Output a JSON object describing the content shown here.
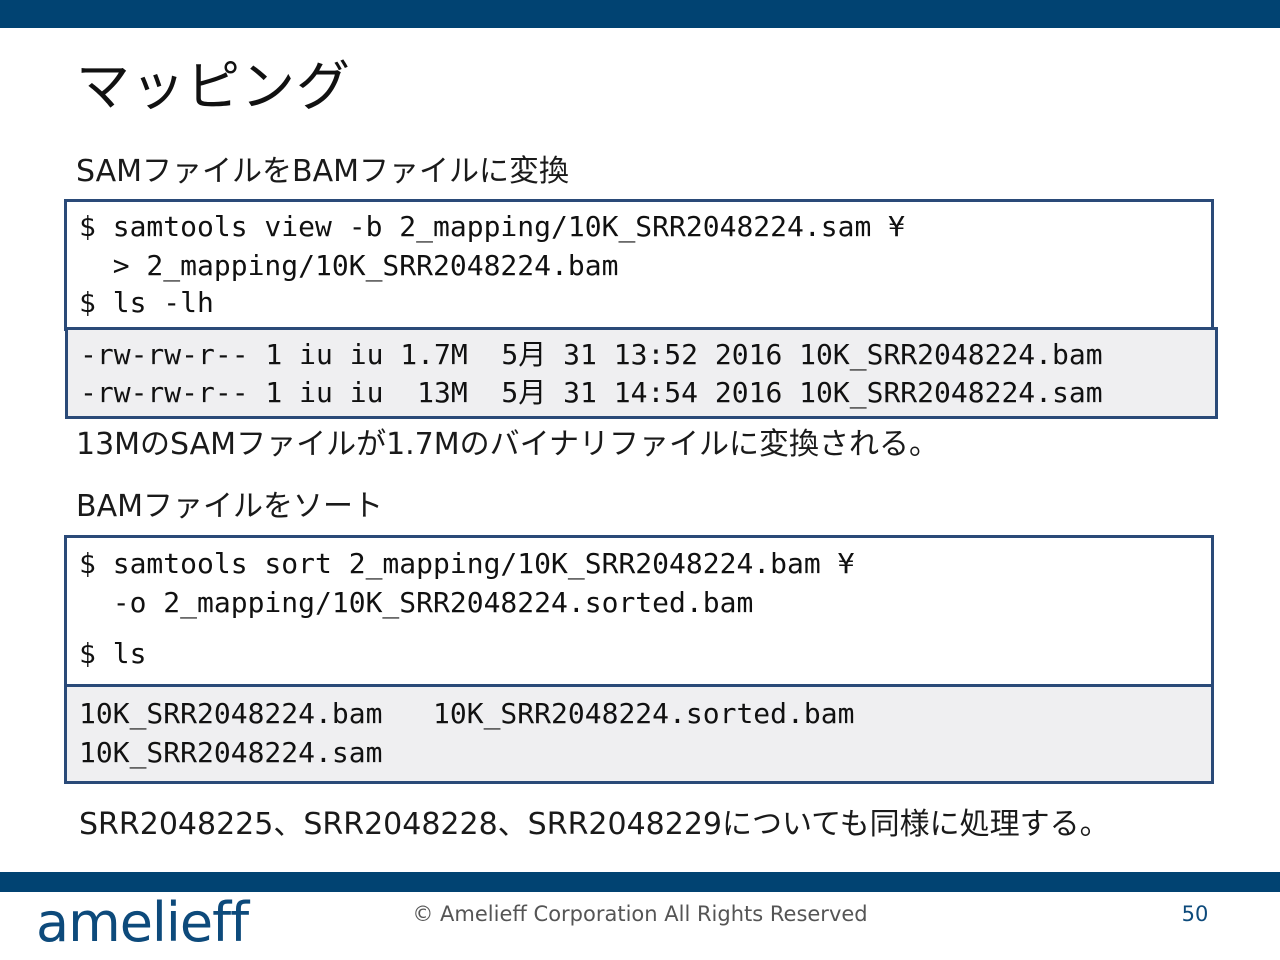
{
  "slide": {
    "title": "マッピング",
    "section1_heading": "SAMファイルをBAMファイルに変換",
    "section1_commands": [
      "$ samtools view -b 2_mapping/10K_SRR2048224.sam ¥",
      "  > 2_mapping/10K_SRR2048224.bam",
      "$ ls -lh"
    ],
    "section1_output": [
      "-rw-rw-r-- 1 iu iu 1.7M  5月 31 13:52 2016 10K_SRR2048224.bam",
      "-rw-rw-r-- 1 iu iu  13M  5月 31 14:54 2016 10K_SRR2048224.sam"
    ],
    "section1_note": "13MのSAMファイルが1.7Mのバイナリファイルに変換される。",
    "section2_heading": "BAMファイルをソート",
    "section2_commands": [
      "$ samtools sort 2_mapping/10K_SRR2048224.bam ¥",
      "  -o 2_mapping/10K_SRR2048224.sorted.bam",
      "$ ls"
    ],
    "section2_output": [
      "10K_SRR2048224.bam   10K_SRR2048224.sorted.bam",
      "10K_SRR2048224.sam"
    ],
    "footer_note": "SRR2048225、SRR2048228、SRR2048229についても同様に処理する。"
  },
  "footer": {
    "logo_text": "amelieff",
    "copyright": "© Amelieff Corporation All Rights Reserved",
    "page_number": "50"
  },
  "colors": {
    "band": "#014372",
    "box_border": "#2a4a78",
    "output_bg": "#efeff1",
    "logo": "#0d4a7b"
  }
}
